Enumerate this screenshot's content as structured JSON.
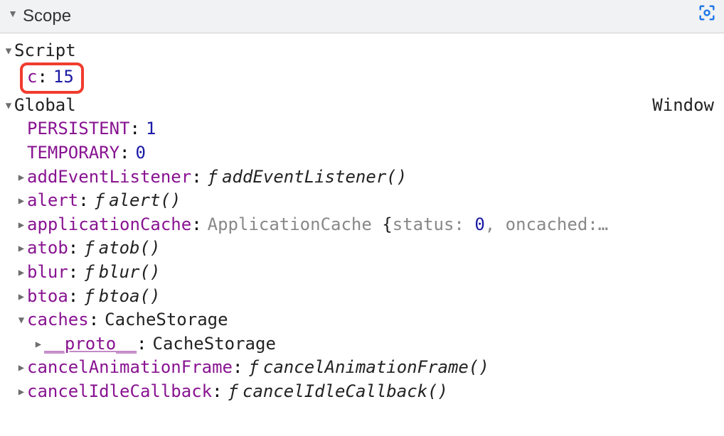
{
  "panel": {
    "title": "Scope"
  },
  "script": {
    "label": "Script",
    "var_key": "c",
    "var_value": "15"
  },
  "global": {
    "label": "Global",
    "type_label": "Window",
    "persistent_key": "PERSISTENT",
    "persistent_value": "1",
    "temporary_key": "TEMPORARY",
    "temporary_value": "0",
    "addEventListener_key": "addEventListener",
    "addEventListener_func": "addEventListener()",
    "alert_key": "alert",
    "alert_func": "alert()",
    "applicationCache_key": "applicationCache",
    "applicationCache_value": "ApplicationCache {status: 0, oncached:…",
    "atob_key": "atob",
    "atob_func": "atob()",
    "blur_key": "blur",
    "blur_func": "blur()",
    "btoa_key": "btoa",
    "btoa_func": "btoa()",
    "caches_key": "caches",
    "caches_value": "CacheStorage",
    "caches_proto_key": "__proto__",
    "caches_proto_value": "CacheStorage",
    "cancelAnimationFrame_key": "cancelAnimationFrame",
    "cancelAnimationFrame_func": "cancelAnimationFrame()",
    "cancelIdleCallback_key": "cancelIdleCallback",
    "cancelIdleCallback_func": "cancelIdleCallback()"
  },
  "f_symbol": "ƒ",
  "applicationCache_prefix": "ApplicationCache ",
  "applicationCache_status_key": "status: ",
  "applicationCache_status_val": "0",
  "applicationCache_rest": ", oncached:…"
}
